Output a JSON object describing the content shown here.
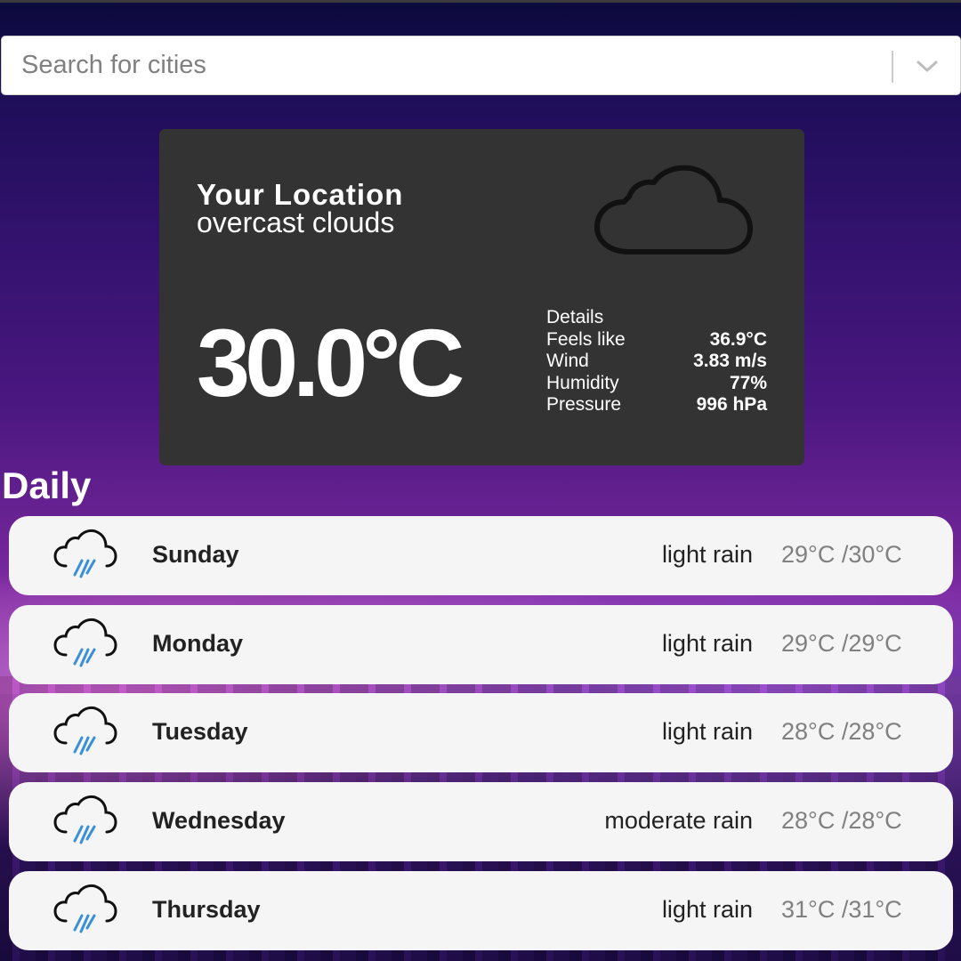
{
  "search": {
    "placeholder": "Search for cities"
  },
  "current": {
    "location": "Your Location",
    "description": "overcast clouds",
    "temperature": "30.0°C",
    "details_label": "Details",
    "details": [
      {
        "label": "Feels like",
        "value": "36.9°C"
      },
      {
        "label": "Wind",
        "value": "3.83 m/s"
      },
      {
        "label": "Humidity",
        "value": "77%"
      },
      {
        "label": "Pressure",
        "value": "996 hPa"
      }
    ],
    "icon": "cloud-icon"
  },
  "daily": {
    "title": "Daily",
    "days": [
      {
        "day": "Sunday",
        "condition": "light rain",
        "range": "29°C /30°C",
        "icon": "rain-cloud-icon"
      },
      {
        "day": "Monday",
        "condition": "light rain",
        "range": "29°C /29°C",
        "icon": "rain-cloud-icon"
      },
      {
        "day": "Tuesday",
        "condition": "light rain",
        "range": "28°C /28°C",
        "icon": "rain-cloud-icon"
      },
      {
        "day": "Wednesday",
        "condition": "moderate rain",
        "range": "28°C /28°C",
        "icon": "rain-cloud-icon"
      },
      {
        "day": "Thursday",
        "condition": "light rain",
        "range": "31°C /31°C",
        "icon": "rain-cloud-icon"
      }
    ]
  },
  "colors": {
    "card_bg": "#333333",
    "row_bg": "#f5f5f5",
    "rain_drops": "#3a8fd8"
  }
}
